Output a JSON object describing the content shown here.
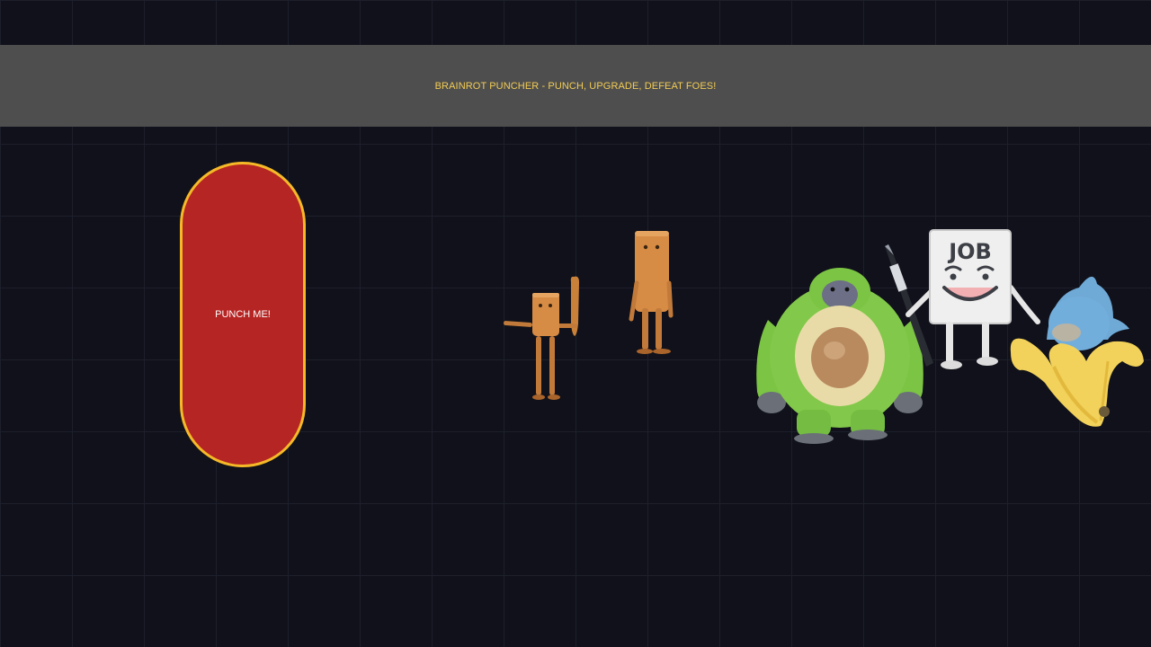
{
  "banner": {
    "title": "BRAINROT PUNCHER - PUNCH, UPGRADE, DEFEAT FOES!"
  },
  "punch_button": {
    "label": "PUNCH ME!"
  },
  "characters": [
    {
      "name": "tung-tung-sahur-bat",
      "icon": "wooden-stick-figure-with-bat"
    },
    {
      "name": "tung-tung-sahur-standing",
      "icon": "wooden-stick-figure-standing"
    },
    {
      "name": "avocado-gorilla",
      "icon": "green-gorilla-avocado"
    },
    {
      "name": "job-paper-character",
      "icon": "paper-with-pen"
    },
    {
      "name": "banana-dolphin",
      "icon": "banana-dolphin"
    }
  ],
  "paper_character": {
    "sign_text": "JOB"
  },
  "colors": {
    "background": "#10111a",
    "banner": "#4e4e4e",
    "banner_text": "#f2cc55",
    "button_fill": "#b52523",
    "button_border": "#f5b928"
  }
}
